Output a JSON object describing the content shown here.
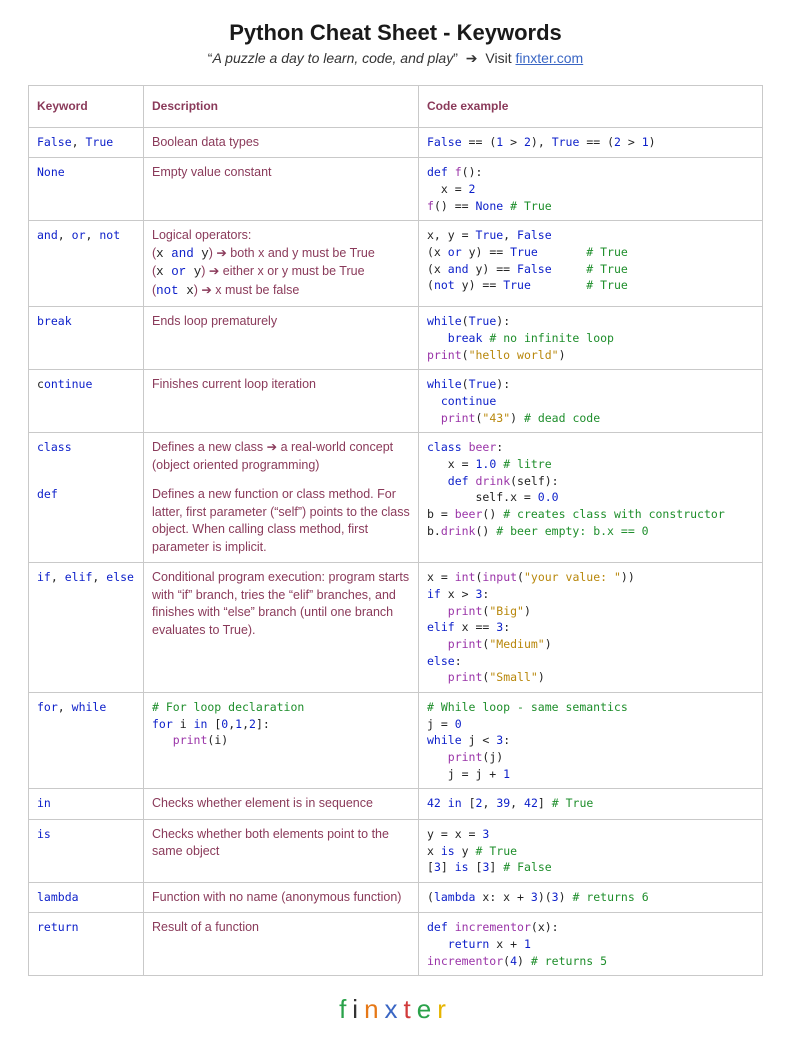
{
  "header": {
    "title": "Python Cheat Sheet - Keywords",
    "quote_open": "“",
    "quote": "A puzzle a day to learn, code, and play",
    "quote_close": "”",
    "arrow": "➔",
    "visit": "Visit ",
    "link_text": "finxter.com"
  },
  "columns": {
    "keyword": "Keyword",
    "description": "Description",
    "code": "Code example"
  },
  "rows": {
    "false_true": {
      "kw_html": "<span class='kw'>False</span>, <span class='kw'>True</span>",
      "desc_text": "Boolean data types",
      "code_html": "<span class='kw'>False</span> == (<span class='num'>1</span> &gt; <span class='num'>2</span>), <span class='kw'>True</span> == (<span class='num'>2</span> &gt; <span class='num'>1</span>)"
    },
    "none": {
      "kw_html": "<span class='kw'>None</span>",
      "desc_text": "Empty value constant",
      "code_html": "<span class='kw'>def</span> <span class='fn'>f</span>():\n  x = <span class='num'>2</span>\n<span class='fn'>f</span>() == <span class='kw'>None</span> <span class='com'># True</span>"
    },
    "and_or_not": {
      "kw_html": "<span class='kw'>and</span>, <span class='kw'>or</span>, <span class='kw'>not</span>",
      "desc_html": "Logical operators:<br>(<span class='code-inline'>x <span class='kw'>and</span> y</span>) ➔ both x and y must be True<br>(<span class='code-inline'>x <span class='kw'>or</span> y</span>) ➔ either x or y must be True<br>(<span class='code-inline'><span class='kw'>not</span> x</span>) ➔ x must be false",
      "code_html": "x, y = <span class='kw'>True</span>, <span class='kw'>False</span>\n(x <span class='kw'>or</span> y) == <span class='kw'>True</span>       <span class='com'># True</span>\n(x <span class='kw'>and</span> y) == <span class='kw'>False</span>     <span class='com'># True</span>\n(<span class='kw'>not</span> y) == <span class='kw'>True</span>        <span class='com'># True</span>"
    },
    "break": {
      "kw_html": "<span class='kw'>break</span>",
      "desc_text": "Ends loop prematurely",
      "code_html": "<span class='kw'>while</span>(<span class='kw'>True</span>):\n   <span class='kw'>break</span> <span class='com'># no infinite loop</span>\n<span class='fn'>print</span>(<span class='str'>\"hello world\"</span>)"
    },
    "continue": {
      "kw_html": "c<span class='kw'>ontinue</span>",
      "desc_text": "Finishes current loop iteration",
      "code_html": "<span class='kw'>while</span>(<span class='kw'>True</span>):\n  <span class='kw'>continue</span>\n  <span class='fn'>print</span>(<span class='str'>\"43\"</span>) <span class='com'># dead code</span>"
    },
    "class_part": {
      "kw_html": "<span class='kw'>class</span>",
      "desc_html": "Defines a new class ➔ a real-world concept<br>(object oriented programming)"
    },
    "def_part": {
      "kw_html": "<span class='kw'>def</span>",
      "desc_html": "Defines a new function or class method. For latter, first parameter (“self”) points to the class object. When calling class method, first parameter is implicit."
    },
    "class_def_code": {
      "code_html": "<span class='kw'>class</span> <span class='fn'>beer</span>:\n   x = <span class='num'>1.0</span> <span class='com'># litre</span>\n   <span class='kw'>def</span> <span class='fn'>drink</span>(self):\n       self.x = <span class='num'>0.0</span>\nb = <span class='fn'>beer</span>() <span class='com'># creates class with constructor</span>\nb.<span class='fn'>drink</span>() <span class='com'># beer empty: b.x == 0</span>"
    },
    "if_elif_else": {
      "kw_html": "<span class='kw'>if</span>, <span class='kw'>elif</span>, <span class='kw'>else</span>",
      "desc_html": "Conditional program execution: program starts with “if” branch, tries the “elif” branches, and finishes with “else” branch (until one branch evaluates to True).",
      "code_html": "x = <span class='fn'>int</span>(<span class='fn'>input</span>(<span class='str'>\"your value: \"</span>))\n<span class='kw'>if</span> x &gt; <span class='num'>3</span>:\n   <span class='fn'>print</span>(<span class='str'>\"Big\"</span>)\n<span class='kw'>elif</span> x == <span class='num'>3</span>:\n   <span class='fn'>print</span>(<span class='str'>\"Medium\"</span>)\n<span class='kw'>else</span>:\n   <span class='fn'>print</span>(<span class='str'>\"Small\"</span>)"
    },
    "for_while": {
      "kw_html": "<span class='kw'>for</span>, <span class='kw'>while</span>",
      "desc_code_html": "<span class='com'># For loop declaration</span>\n<span class='kw'>for</span> i <span class='kw'>in</span> [<span class='num'>0</span>,<span class='num'>1</span>,<span class='num'>2</span>]:\n   <span class='fn'>print</span>(i)",
      "code_html": "<span class='com'># While loop - same semantics</span>\nj = <span class='num'>0</span>\n<span class='kw'>while</span> j &lt; <span class='num'>3</span>:\n   <span class='fn'>print</span>(j)\n   j = j + <span class='num'>1</span>"
    },
    "in": {
      "kw_html": "<span class='kw'>in</span>",
      "desc_text": "Checks whether element is in sequence",
      "code_html": "<span class='num'>42</span> <span class='kw'>in</span> [<span class='num'>2</span>, <span class='num'>39</span>, <span class='num'>42</span>] <span class='com'># True</span>"
    },
    "is": {
      "kw_html": "<span class='kw'>is</span>",
      "desc_text": "Checks whether both elements point to the same object",
      "code_html": "y = x = <span class='num'>3</span>\nx <span class='kw'>is</span> y <span class='com'># True</span>\n[<span class='num'>3</span>] <span class='kw'>is</span> [<span class='num'>3</span>] <span class='com'># False</span>"
    },
    "lambda": {
      "kw_html": "<span class='kw'>lambda</span>",
      "desc_text": "Function with no name (anonymous function)",
      "code_html": "(<span class='kw'>lambda</span> x: x + <span class='num'>3</span>)(<span class='num'>3</span>) <span class='com'># returns 6</span>"
    },
    "return": {
      "kw_html": "<span class='kw'>return</span>",
      "desc_text": "Result of a function",
      "code_html": "<span class='kw'>def</span> <span class='fn'>incrementor</span>(x):\n   <span class='kw'>return</span> x + <span class='num'>1</span>\n<span class='fn'>incrementor</span>(<span class='num'>4</span>) <span class='com'># returns 5</span>"
    }
  },
  "logo": {
    "letters": [
      "f",
      "i",
      "n",
      "x",
      "t",
      "e",
      "r"
    ],
    "colors": [
      "#2aa24a",
      "#333333",
      "#e67817",
      "#3a66c4",
      "#d13a3a",
      "#2aa24a",
      "#e6b400"
    ]
  }
}
